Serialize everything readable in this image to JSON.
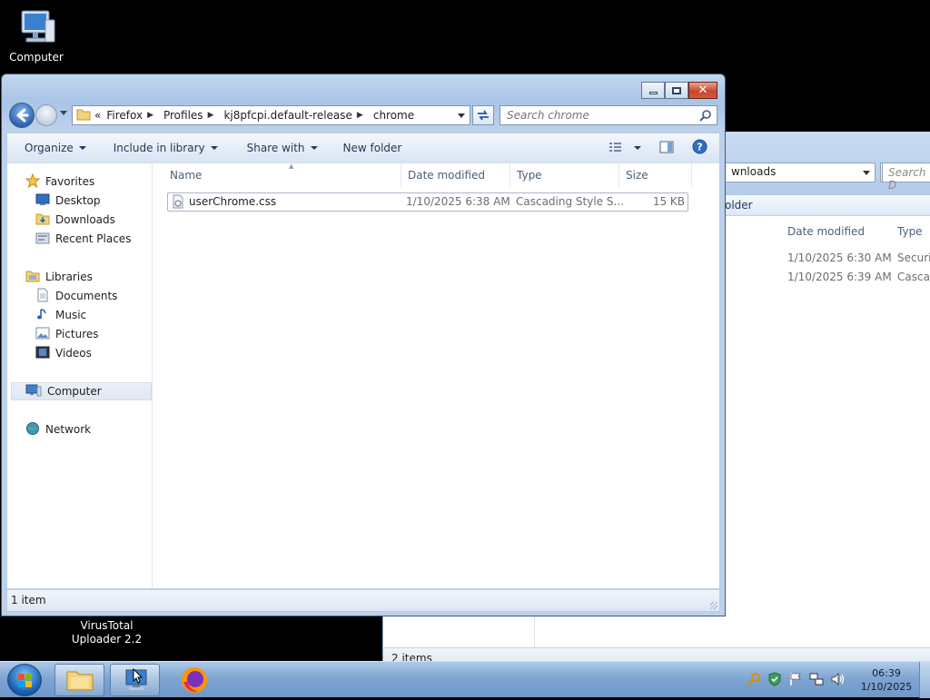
{
  "desktop": {
    "computer_label": "Computer",
    "vt_line1": "VirusTotal",
    "vt_line2": "Uploader 2.2"
  },
  "bg_window": {
    "address_text": "wnloads",
    "search_placeholder": "Search D",
    "cmd_label": "older",
    "col_date": "Date modified",
    "col_type": "Type",
    "rows": [
      {
        "date": "1/10/2025 6:30 AM",
        "type": "Securit"
      },
      {
        "date": "1/10/2025 6:39 AM",
        "type": "Cascad"
      }
    ],
    "status": "2 items"
  },
  "window": {
    "breadcrumb": {
      "overflow": "«",
      "items": [
        "Firefox",
        "Profiles",
        "kj8pfcpi.default-release",
        "chrome"
      ]
    },
    "search_placeholder": "Search chrome",
    "commands": {
      "organize": "Organize",
      "include_library": "Include in library",
      "share_with": "Share with",
      "new_folder": "New folder"
    },
    "nav": {
      "favorites": "Favorites",
      "desktop": "Desktop",
      "downloads": "Downloads",
      "recent_places": "Recent Places",
      "libraries": "Libraries",
      "documents": "Documents",
      "music": "Music",
      "pictures": "Pictures",
      "videos": "Videos",
      "computer": "Computer",
      "network": "Network"
    },
    "columns": {
      "name": "Name",
      "date": "Date modified",
      "type": "Type",
      "size": "Size"
    },
    "files": [
      {
        "name": "userChrome.css",
        "date": "1/10/2025 6:38 AM",
        "type": "Cascading Style S...",
        "size": "15 KB"
      }
    ],
    "status": "1 item"
  },
  "taskbar": {
    "time": "06:39",
    "date": "1/10/2025"
  }
}
